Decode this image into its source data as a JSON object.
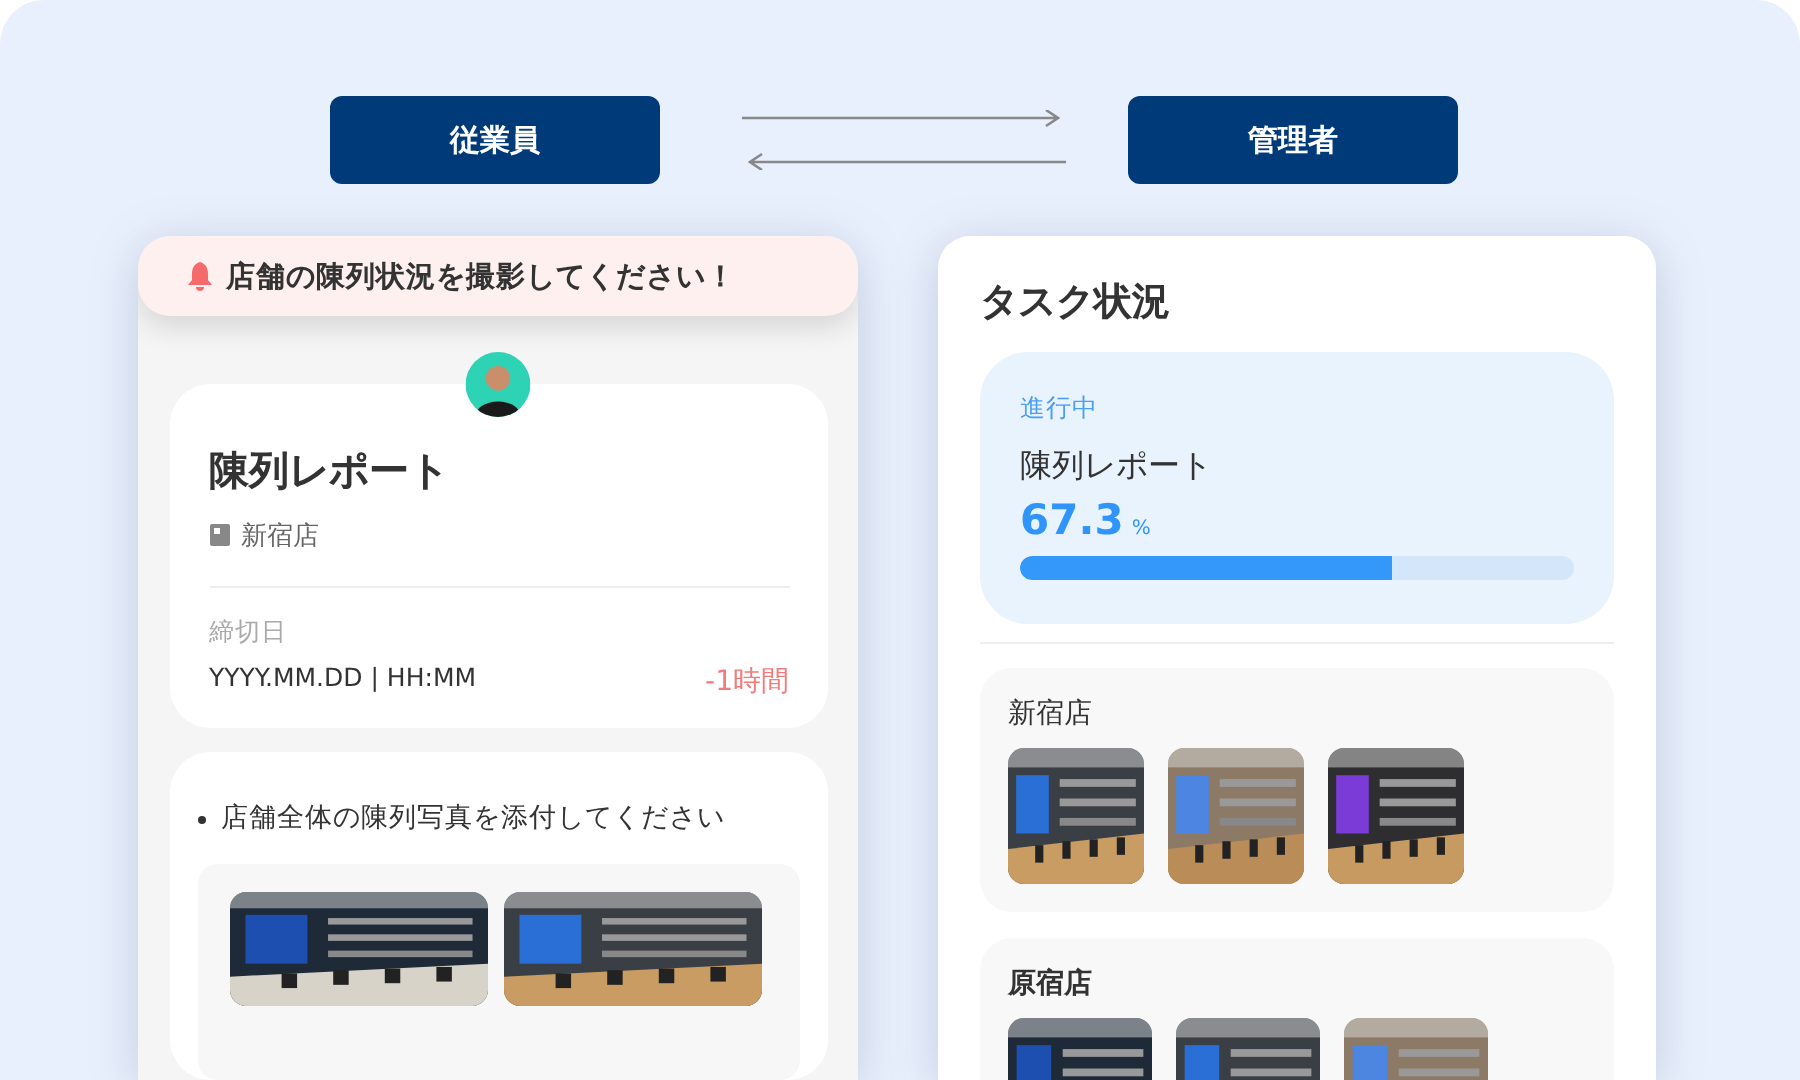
{
  "roles": [
    {
      "label": "従業員"
    },
    {
      "label": "管理者"
    }
  ],
  "employee": {
    "alert": "店舗の陳列状況を撮影してください！",
    "task": {
      "title": "陳列レポート",
      "store": "新宿店",
      "deadline_label": "締切日",
      "deadline": "YYYY.MM.DD | HH:MM",
      "remaining": "-1時間"
    },
    "instruction": "店舗全体の陳列写真を添付してください"
  },
  "manager": {
    "title": "タスク状況",
    "progress": {
      "status": "進行中",
      "title": "陳列レポート",
      "value": "67.3",
      "unit": "%",
      "level": 0.673
    },
    "stores": [
      {
        "name": "新宿店"
      },
      {
        "name": "原宿店"
      }
    ]
  }
}
